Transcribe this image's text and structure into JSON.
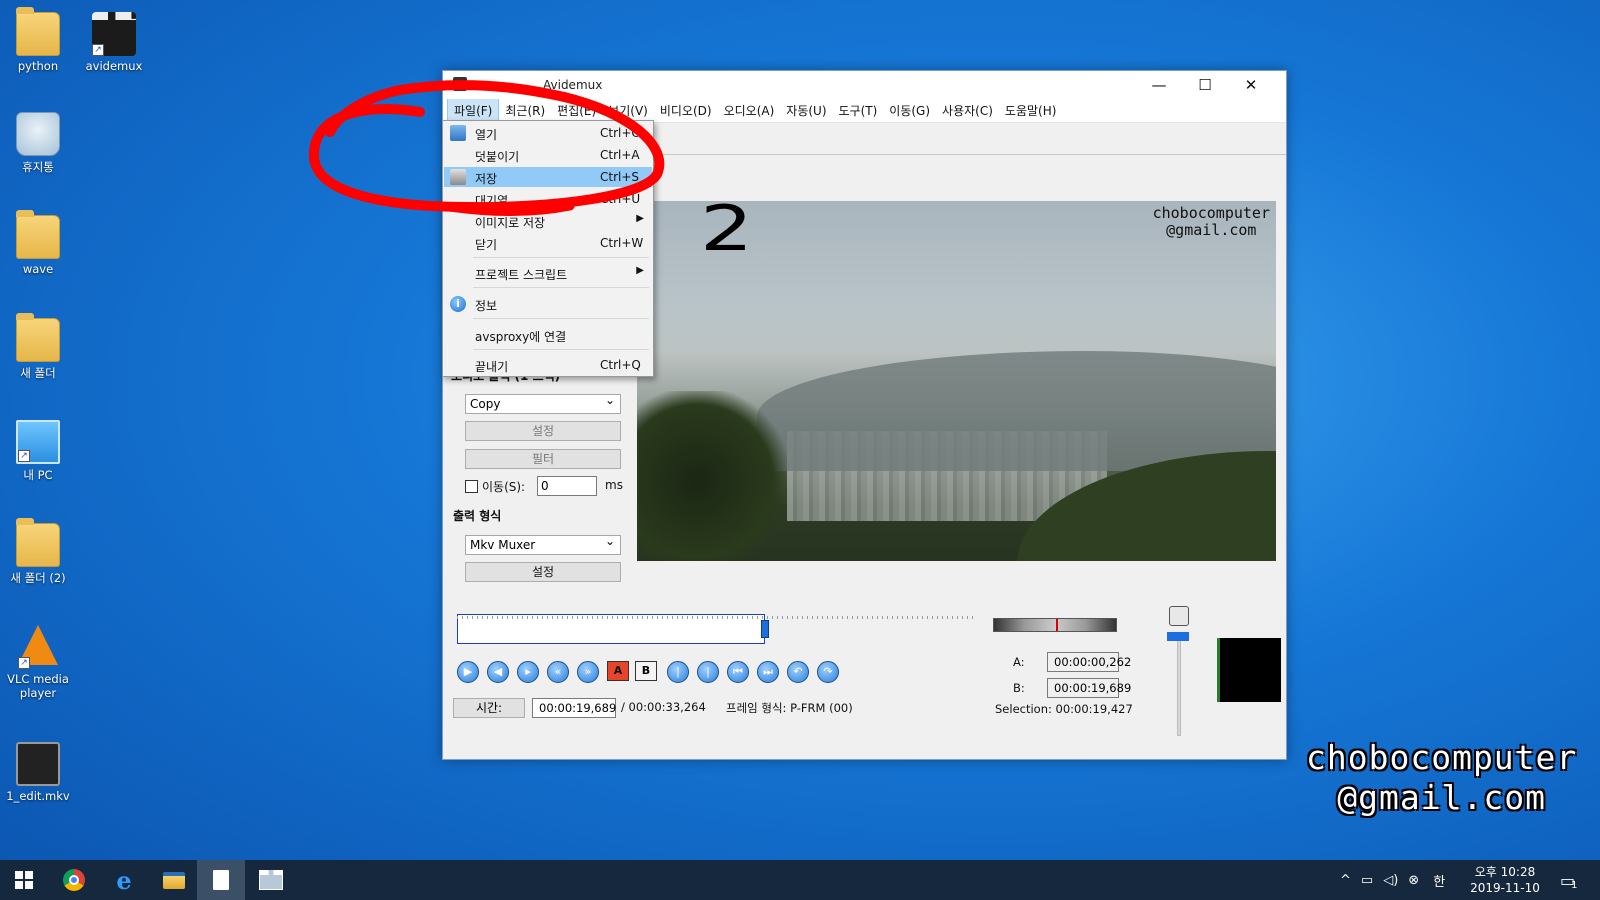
{
  "desktop": {
    "icons": [
      {
        "label": "python",
        "kind": "folder"
      },
      {
        "label": "avidemux",
        "kind": "app-shortcut"
      },
      {
        "label": "휴지통",
        "kind": "recycle-bin"
      },
      {
        "label": "wave",
        "kind": "folder"
      },
      {
        "label": "새 폴더",
        "kind": "folder"
      },
      {
        "label": "내 PC",
        "kind": "this-pc"
      },
      {
        "label": "새 폴더 (2)",
        "kind": "folder"
      },
      {
        "label": "VLC media player",
        "kind": "vlc"
      },
      {
        "label": "1_edit.mkv",
        "kind": "video-file"
      }
    ]
  },
  "window": {
    "title": "Avidemux",
    "controls": {
      "minimize": "—",
      "maximize": "☐",
      "close": "✕"
    },
    "menu": [
      "파일(F)",
      "최근(R)",
      "편집(E)",
      "보기(V)",
      "비디오(D)",
      "오디오(A)",
      "자동(U)",
      "도구(T)",
      "이동(G)",
      "사용자(C)",
      "도움말(H)"
    ],
    "active_menu_index": 0
  },
  "file_menu": {
    "items": [
      {
        "label": "열기",
        "shortcut": "Ctrl+O",
        "icon": "open-folder-icon"
      },
      {
        "label": "덧붙이기",
        "shortcut": "Ctrl+A"
      },
      {
        "label": "저장",
        "shortcut": "Ctrl+S",
        "icon": "save-icon",
        "highlighted": true
      },
      {
        "label": "대기열",
        "shortcut": "Ctrl+U"
      },
      {
        "label": "이미지로 저장",
        "submenu": true
      },
      {
        "label": "닫기",
        "shortcut": "Ctrl+W"
      },
      {
        "label": "프로젝트 스크립트",
        "submenu": true
      },
      {
        "label": "정보",
        "icon": "info-icon"
      },
      {
        "label": "avsproxy에 연결"
      },
      {
        "label": "끝내기",
        "shortcut": "Ctrl+Q"
      }
    ]
  },
  "left_panel": {
    "audio_output_header": "오디오 출력 (1 트랙)",
    "audio_codec": "Copy",
    "settings_label": "설정",
    "filter_label": "필터",
    "shift_label": "이동(S):",
    "shift_value": "0",
    "shift_unit": "ms",
    "output_format_header": "출력 형식",
    "muxer": "Mkv Muxer",
    "muxer_settings_label": "설정"
  },
  "video_watermark": [
    "chobocomputer",
    "@gmail.com"
  ],
  "transport": {
    "time_label": "시간:",
    "current_time": "00:00:19,689",
    "total_time": "/ 00:00:33,264",
    "frame_type": "프레임 형식: P-FRM (00)",
    "marker_a_label": "A:",
    "marker_a": "00:00:00,262",
    "marker_b_label": "B:",
    "marker_b": "00:00:19,689",
    "selection": "Selection: 00:00:19,427",
    "buttons": [
      "play",
      "prev-frame",
      "next-frame",
      "prev-keyframe",
      "next-keyframe",
      "set-marker-a",
      "set-marker-b",
      "goto-marker-a",
      "goto-marker-b",
      "prev-black",
      "next-black",
      "goto-start",
      "goto-end"
    ],
    "slider_position": 0.59
  },
  "annotations": {
    "handwritten_number": "2",
    "watermark_lines": [
      "chobocomputer",
      "@gmail.com"
    ],
    "circle_color": "#ff0000"
  },
  "taskbar": {
    "clock_line1": "오후 10:28",
    "clock_line2": "2019-11-10",
    "ime": "한",
    "notification_count": "1"
  }
}
